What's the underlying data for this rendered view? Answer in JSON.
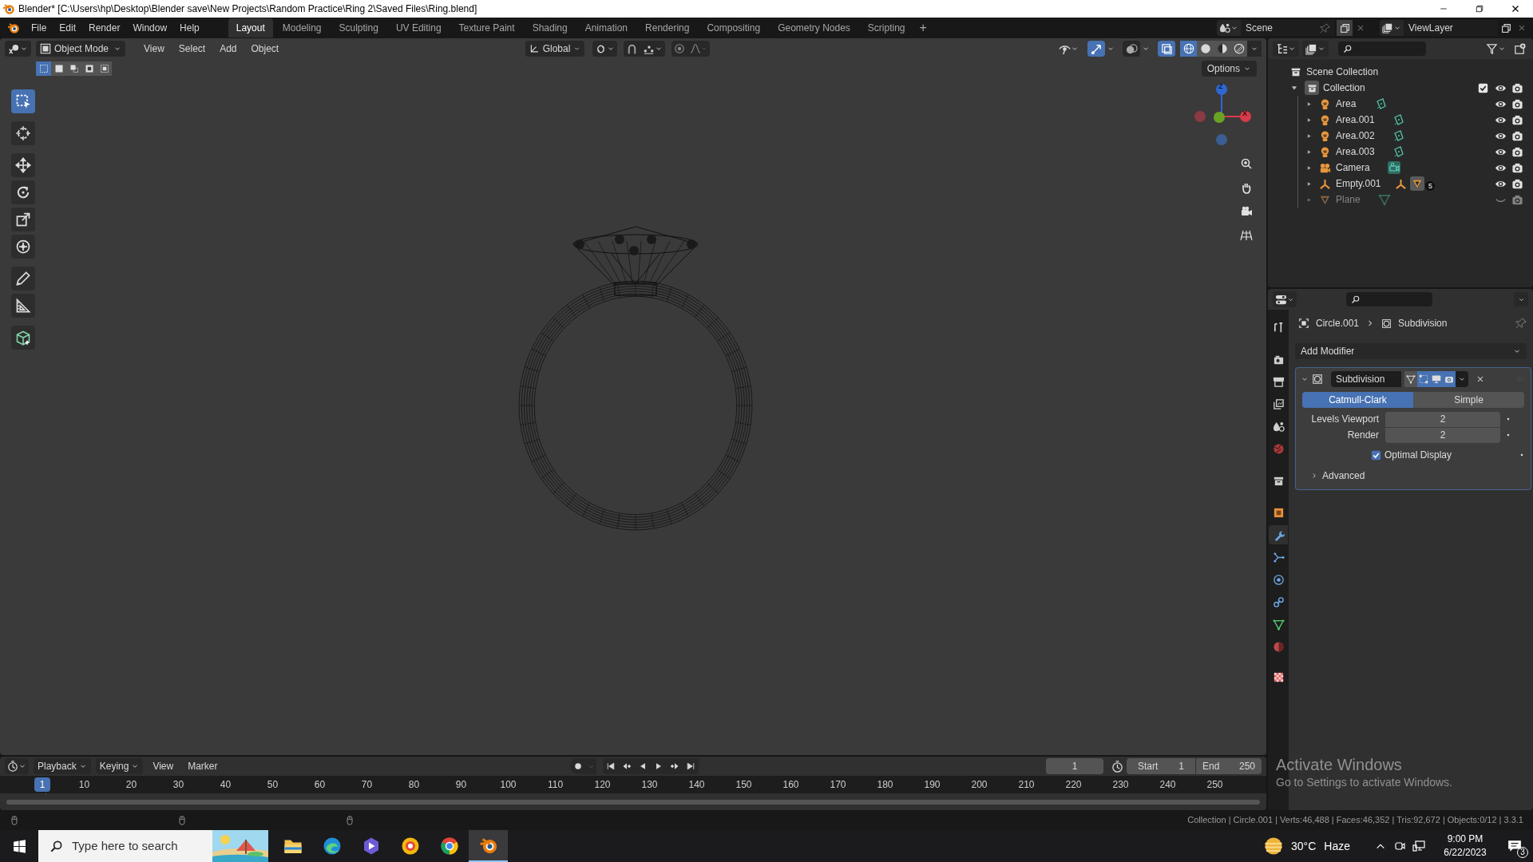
{
  "window": {
    "title": "Blender* [C:\\Users\\hp\\Desktop\\Blender save\\New Projects\\Random Practice\\Ring 2\\Saved Files\\Ring.blend]"
  },
  "menu": [
    "File",
    "Edit",
    "Render",
    "Window",
    "Help"
  ],
  "workspaces": [
    {
      "label": "Layout",
      "selected": true
    },
    {
      "label": "Modeling",
      "selected": false
    },
    {
      "label": "Sculpting",
      "selected": false
    },
    {
      "label": "UV Editing",
      "selected": false
    },
    {
      "label": "Texture Paint",
      "selected": false
    },
    {
      "label": "Shading",
      "selected": false
    },
    {
      "label": "Animation",
      "selected": false
    },
    {
      "label": "Rendering",
      "selected": false
    },
    {
      "label": "Compositing",
      "selected": false
    },
    {
      "label": "Geometry Nodes",
      "selected": false
    },
    {
      "label": "Scripting",
      "selected": false
    }
  ],
  "add_workspace": "+",
  "scene": "Scene",
  "view_layer": "ViewLayer",
  "viewport": {
    "mode": "Object Mode",
    "menus": [
      "View",
      "Select",
      "Add",
      "Object"
    ],
    "orientation": "Global",
    "options": "Options",
    "toggles": [
      {
        "kind": "gizmo",
        "on": true
      },
      {
        "kind": "overlay",
        "on": false
      },
      {
        "kind": "xray",
        "on": true
      }
    ],
    "shading": [
      {
        "kind": "wireframe",
        "selected": true
      },
      {
        "kind": "solid",
        "selected": false
      },
      {
        "kind": "material",
        "selected": false
      },
      {
        "kind": "rendered",
        "selected": false
      }
    ],
    "select_modes": [
      {
        "kind": "set",
        "selected": true
      },
      {
        "kind": "extend",
        "selected": false
      },
      {
        "kind": "subtract",
        "selected": false
      },
      {
        "kind": "invert",
        "selected": false
      },
      {
        "kind": "intersect",
        "selected": false
      }
    ],
    "tools": [
      {
        "kind": "select",
        "selected": true
      },
      {
        "kind": "cursor",
        "selected": false
      },
      {
        "kind": "move",
        "selected": false
      },
      {
        "kind": "rotate",
        "selected": false
      },
      {
        "kind": "scale",
        "selected": false
      },
      {
        "kind": "transform",
        "selected": false
      },
      {
        "kind": "annotate",
        "selected": false
      },
      {
        "kind": "measure",
        "selected": false
      },
      {
        "kind": "add_cube",
        "selected": false
      }
    ],
    "gizmo": {
      "z": "Z",
      "x": "X"
    }
  },
  "outliner": {
    "root": "Scene Collection",
    "items": [
      {
        "label": "Collection",
        "kind": "collection",
        "expanded": true,
        "checked": true,
        "children": [
          {
            "label": "Area",
            "kind": "light",
            "visible": true
          },
          {
            "label": "Area.001",
            "kind": "light",
            "visible": true
          },
          {
            "label": "Area.002",
            "kind": "light",
            "visible": true
          },
          {
            "label": "Area.003",
            "kind": "light",
            "visible": true
          },
          {
            "label": "Camera",
            "kind": "camera",
            "visible": true
          },
          {
            "label": "Empty.001",
            "kind": "empty",
            "visible": true,
            "child_count": "5"
          },
          {
            "label": "Plane",
            "kind": "mesh",
            "visible": false
          }
        ]
      }
    ]
  },
  "properties": {
    "tabs": [
      {
        "kind": "tool",
        "selected": false
      },
      {
        "kind": "render",
        "selected": false
      },
      {
        "kind": "output",
        "selected": false
      },
      {
        "kind": "view_layer",
        "selected": false
      },
      {
        "kind": "scene",
        "selected": false
      },
      {
        "kind": "world",
        "selected": false
      },
      {
        "kind": "collection",
        "selected": false
      },
      {
        "kind": "object",
        "selected": false
      },
      {
        "kind": "modifier",
        "selected": true
      },
      {
        "kind": "particles",
        "selected": false
      },
      {
        "kind": "physics",
        "selected": false
      },
      {
        "kind": "constraints",
        "selected": false
      },
      {
        "kind": "data",
        "selected": false
      },
      {
        "kind": "material",
        "selected": false
      },
      {
        "kind": "texture",
        "selected": false
      }
    ],
    "object": "Circle.001",
    "modifier": "Subdivision",
    "add_modifier": "Add Modifier",
    "panel": {
      "name": "Subdivision",
      "expanded": true,
      "types": [
        {
          "label": "Catmull-Clark",
          "selected": true
        },
        {
          "label": "Simple",
          "selected": false
        }
      ],
      "fields": [
        {
          "label": "Levels Viewport",
          "value": "2"
        },
        {
          "label": "Render",
          "value": "2"
        }
      ],
      "optimal_display": {
        "label": "Optimal Display",
        "checked": true
      },
      "advanced": {
        "label": "Advanced",
        "expanded": false
      }
    }
  },
  "timeline": {
    "menus": [
      "Playback",
      "Keying",
      "View",
      "Marker"
    ],
    "current_frame": "1",
    "start_label": "Start",
    "start": "1",
    "end_label": "End",
    "end": "250",
    "ticks": [
      "1",
      "10",
      "20",
      "30",
      "40",
      "50",
      "60",
      "70",
      "80",
      "90",
      "100",
      "110",
      "120",
      "130",
      "140",
      "150",
      "160",
      "170",
      "180",
      "190",
      "200",
      "210",
      "220",
      "230",
      "240",
      "250"
    ]
  },
  "status_bar": "Collection | Circle.001 | Verts:46,488 | Faces:46,352 | Tris:92,672 | Objects:0/12 | 3.3.1",
  "activation": {
    "title": "Activate Windows",
    "text": "Go to Settings to activate Windows."
  },
  "taskbar": {
    "search_placeholder": "Type here to search",
    "temperature": "30°C",
    "weather": "Haze",
    "time": "9:00 PM",
    "date": "6/22/2023",
    "notifications": "3"
  }
}
